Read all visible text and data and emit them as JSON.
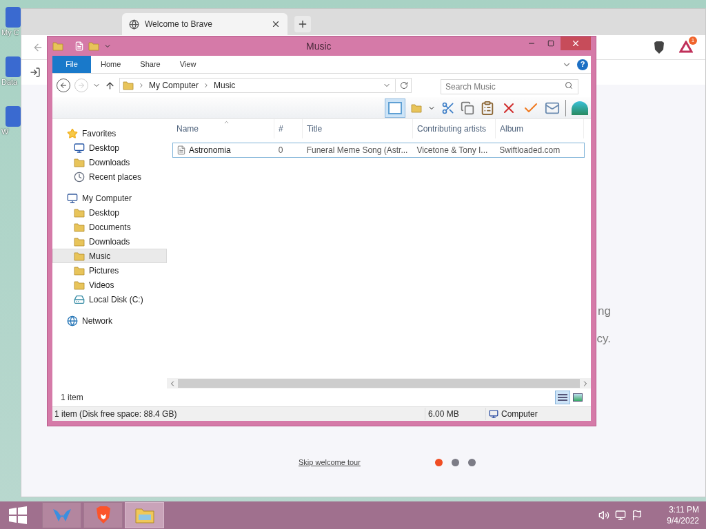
{
  "desktop_icons": [
    {
      "label": "My C"
    },
    {
      "label": "Data"
    },
    {
      "label": "W"
    }
  ],
  "browser": {
    "tab": {
      "title": "Welcome to Brave"
    },
    "badge": "1",
    "text_fragments": [
      "ng",
      "cy."
    ],
    "skip_link": "Skip welcome tour",
    "dots": [
      {
        "selected": true
      },
      {
        "selected": false
      },
      {
        "selected": false
      }
    ]
  },
  "explorer": {
    "title": "Music",
    "ribbon_tabs": [
      {
        "label": "File",
        "kind": "file"
      },
      {
        "label": "Home",
        "kind": "tab"
      },
      {
        "label": "Share",
        "kind": "tab"
      },
      {
        "label": "View",
        "kind": "tab"
      }
    ],
    "breadcrumb": [
      "My Computer",
      "Music"
    ],
    "search": {
      "placeholder": "Search Music"
    },
    "help_label": "?",
    "nav": [
      {
        "label": "Favorites",
        "kind": "star",
        "selected": false,
        "children": [
          {
            "label": "Desktop",
            "kind": "desktop",
            "selected": false
          },
          {
            "label": "Downloads",
            "kind": "downloads",
            "selected": false
          },
          {
            "label": "Recent places",
            "kind": "recent",
            "selected": false
          }
        ]
      },
      {
        "label": "My Computer",
        "kind": "computer",
        "selected": false,
        "children": [
          {
            "label": "Desktop",
            "kind": "folder",
            "selected": false
          },
          {
            "label": "Documents",
            "kind": "folder",
            "selected": false
          },
          {
            "label": "Downloads",
            "kind": "folder",
            "selected": false
          },
          {
            "label": "Music",
            "kind": "folder",
            "selected": true
          },
          {
            "label": "Pictures",
            "kind": "folder",
            "selected": false
          },
          {
            "label": "Videos",
            "kind": "folder",
            "selected": false
          },
          {
            "label": "Local Disk (C:)",
            "kind": "disk",
            "selected": false
          }
        ]
      },
      {
        "label": "Network",
        "kind": "network",
        "selected": false
      }
    ],
    "columns": [
      "Name",
      "#",
      "Title",
      "Contributing artists",
      "Album"
    ],
    "rows": [
      {
        "cells": [
          "Astronomia",
          "0",
          "Funeral Meme Song (Astr...",
          "Vicetone & Tony I...",
          "Swiftloaded.com"
        ],
        "selected": true
      }
    ],
    "item_count": "1 item",
    "status": {
      "summary": "1 item (Disk free space: 88.4 GB)",
      "size": "6.00 MB",
      "location": "Computer"
    }
  },
  "taskbar": {
    "apps": [
      {
        "kind": "app",
        "active": false
      },
      {
        "kind": "brave",
        "active": false
      },
      {
        "kind": "explorer",
        "active": true
      }
    ],
    "time": "3:11 PM",
    "date": "9/4/2022"
  }
}
